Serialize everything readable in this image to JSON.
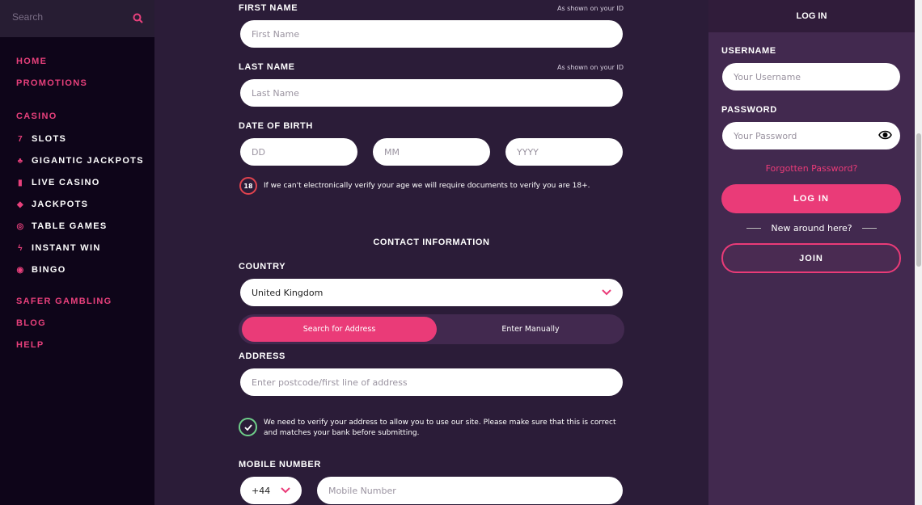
{
  "sidebar": {
    "search_placeholder": "Search",
    "items": [
      {
        "label": "HOME",
        "icon": "none"
      },
      {
        "label": "PROMOTIONS",
        "icon": "none"
      },
      {
        "label": "CASINO",
        "icon": "none"
      },
      {
        "label": "SLOTS",
        "icon": "slot-seven-icon"
      },
      {
        "label": "GIGANTIC JACKPOTS",
        "icon": "coins-icon"
      },
      {
        "label": "LIVE CASINO",
        "icon": "card-icon"
      },
      {
        "label": "JACKPOTS",
        "icon": "diamond-icon"
      },
      {
        "label": "TABLE GAMES",
        "icon": "roulette-icon"
      },
      {
        "label": "INSTANT WIN",
        "icon": "lightning-icon"
      },
      {
        "label": "BINGO",
        "icon": "bingo-ball-icon"
      },
      {
        "label": "SAFER GAMBLING",
        "icon": "none"
      },
      {
        "label": "BLOG",
        "icon": "none"
      },
      {
        "label": "HELP",
        "icon": "none"
      }
    ]
  },
  "form": {
    "first_name": {
      "label": "FIRST NAME",
      "hint": "As shown on your ID",
      "placeholder": "First Name"
    },
    "last_name": {
      "label": "LAST NAME",
      "hint": "As shown on your ID",
      "placeholder": "Last Name"
    },
    "dob": {
      "label": "DATE OF BIRTH",
      "dd": "DD",
      "mm": "MM",
      "yyyy": "YYYY"
    },
    "age_badge": "18",
    "age_note": "If we can't electronically verify your age we will require documents to verify you are 18+.",
    "contact_heading": "CONTACT INFORMATION",
    "country": {
      "label": "COUNTRY",
      "value": "United Kingdom"
    },
    "address_tabs": {
      "active": "Search for Address",
      "inactive": "Enter Manually"
    },
    "address": {
      "label": "ADDRESS",
      "placeholder": "Enter postcode/first line of address"
    },
    "address_note": "We need to verify your address to allow you to use our site. Please make sure that this is correct and matches your bank before submitting.",
    "mobile": {
      "label": "MOBILE NUMBER",
      "code": "+44",
      "placeholder": "Mobile Number"
    }
  },
  "login": {
    "title": "LOG IN",
    "username_label": "USERNAME",
    "username_placeholder": "Your Username",
    "password_label": "PASSWORD",
    "password_placeholder": "Your Password",
    "forgot": "Forgotten Password?",
    "login_button": "LOG IN",
    "new_here": "New around here?",
    "join_button": "JOIN"
  },
  "colors": {
    "accent": "#ea3b78",
    "sidebar": "#0e0519",
    "main": "#2b1c38",
    "panel": "#42294f",
    "success": "#6fcf8a",
    "age_ring": "#e0434e"
  }
}
